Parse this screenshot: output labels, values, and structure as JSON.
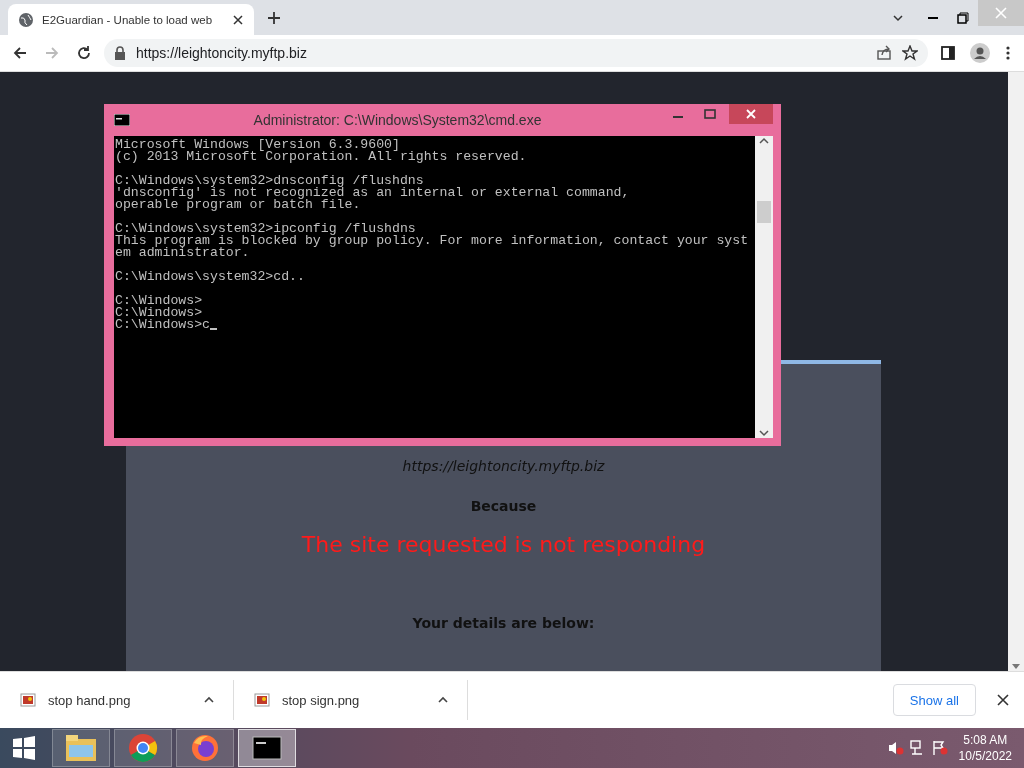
{
  "browser": {
    "tabs": [
      {
        "title": "E2Guardian - Unable to load web",
        "selected": true
      }
    ],
    "address": "https://leightoncity.myftp.biz"
  },
  "page": {
    "url": "https://leightoncity.myftp.biz",
    "because": "Because",
    "reason": "The site requested is not responding",
    "details_heading": "Your details are below:"
  },
  "console": {
    "title": "Administrator: C:\\Windows\\System32\\cmd.exe",
    "blocks": [
      [
        "Microsoft Windows [Version 6.3.9600]",
        "(c) 2013 Microsoft Corporation. All rights reserved."
      ],
      [
        "C:\\Windows\\system32>dnsconfig /flushdns",
        "'dnsconfig' is not recognized as an internal or external command,",
        "operable program or batch file."
      ],
      [
        "C:\\Windows\\system32>ipconfig /flushdns",
        "This program is blocked by group policy. For more information, contact your syst",
        "em administrator."
      ],
      [
        "C:\\Windows\\system32>cd.."
      ],
      [
        "C:\\Windows>",
        "C:\\Windows>",
        "C:\\Windows>c"
      ]
    ]
  },
  "downloads": {
    "items": [
      {
        "name": "stop hand.png"
      },
      {
        "name": "stop sign.png"
      }
    ],
    "show_all": "Show all"
  },
  "taskbar": {
    "apps": [
      {
        "kind": "explorer",
        "selected": false
      },
      {
        "kind": "chrome",
        "selected": false
      },
      {
        "kind": "firefox",
        "selected": false
      },
      {
        "kind": "console",
        "selected": true
      }
    ],
    "time": "5:08 AM",
    "date": "10/5/2022"
  }
}
